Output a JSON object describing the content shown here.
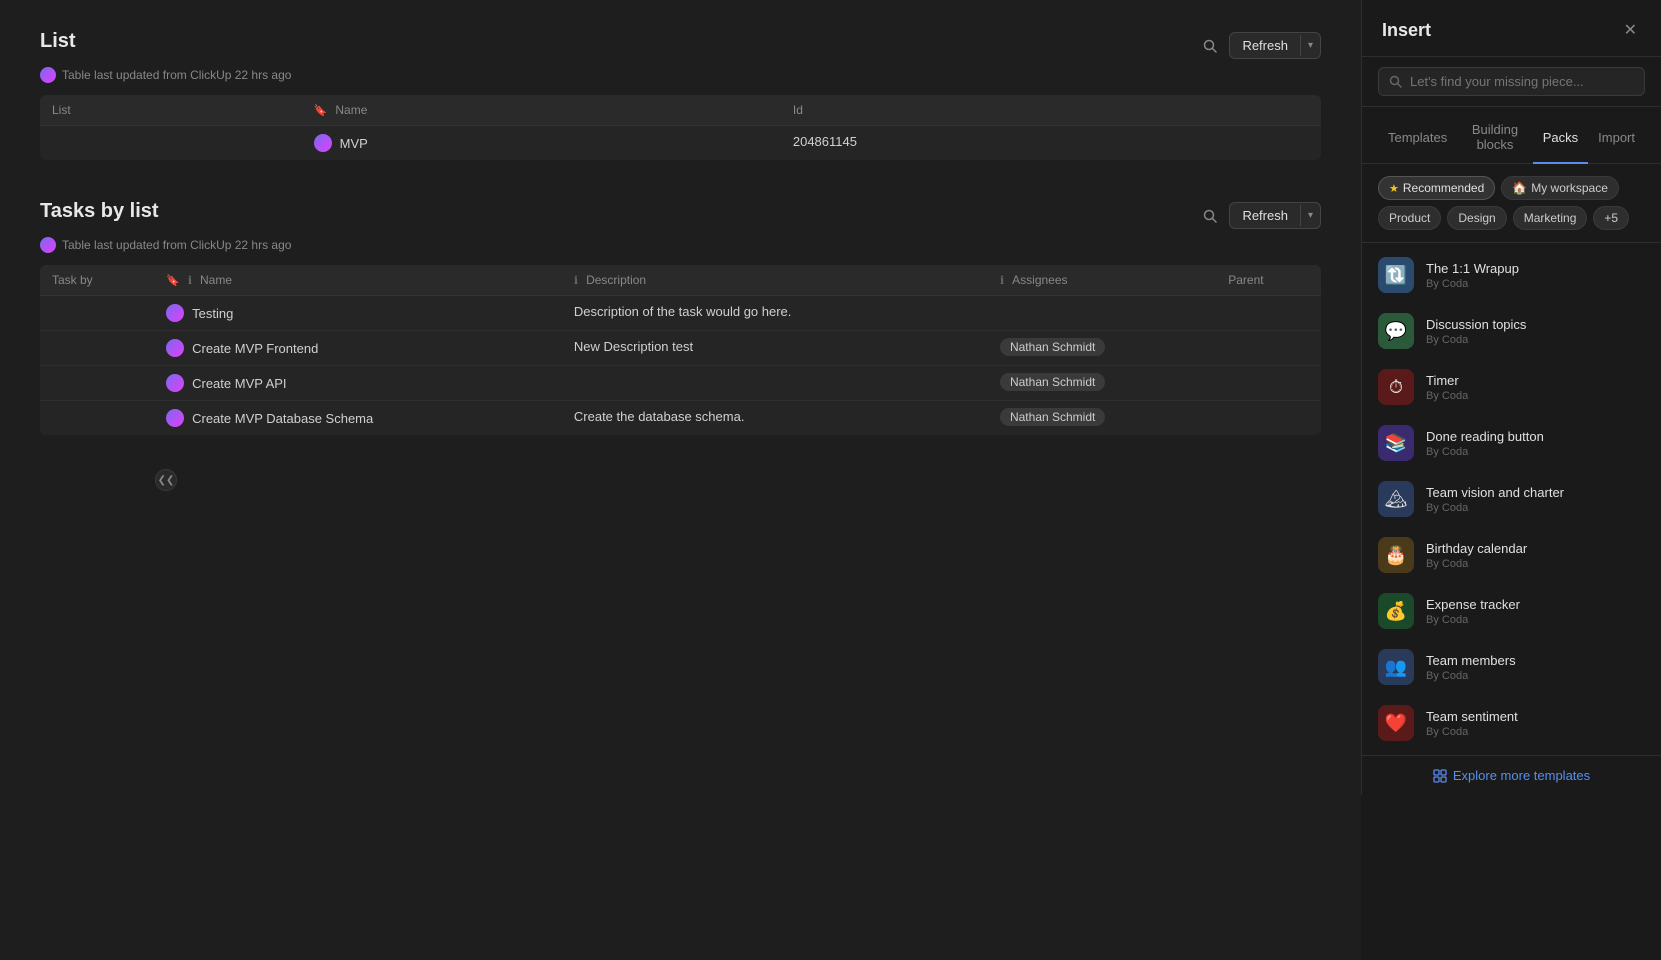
{
  "leftToggle": "❮❮",
  "mainContent": {
    "listSection": {
      "title": "List",
      "tableMeta": "Table last updated from ClickUp 22 hrs ago",
      "refreshBtn": "Refresh",
      "columns": [
        "List",
        "Name",
        "Id"
      ],
      "rows": [
        {
          "list": "",
          "name": "MVP",
          "id": "204861145"
        }
      ]
    },
    "tasksByListSection": {
      "title": "Tasks by list",
      "tableMeta": "Table last updated from ClickUp 22 hrs ago",
      "refreshBtn": "Refresh",
      "columns": [
        "Task by",
        "Name",
        "Description",
        "Assignees",
        "Parent"
      ],
      "rows": [
        {
          "name": "Testing",
          "description": "Description of the task would go here.",
          "assignees": "",
          "parent": ""
        },
        {
          "name": "Create MVP Frontend",
          "description": "New Description test",
          "assignees": "Nathan Schmidt",
          "parent": ""
        },
        {
          "name": "Create MVP API",
          "description": "",
          "assignees": "Nathan Schmidt",
          "parent": ""
        },
        {
          "name": "Create MVP Database Schema",
          "description": "Create the database schema.",
          "assignees": "Nathan Schmidt",
          "parent": ""
        }
      ]
    }
  },
  "rightPanel": {
    "title": "Insert",
    "searchPlaceholder": "Let's find your missing piece...",
    "tabs": [
      "Templates",
      "Building blocks",
      "Packs",
      "Import"
    ],
    "activeTab": "Packs",
    "filters": {
      "recommended": "Recommended",
      "myWorkspace": "My workspace",
      "product": "Product",
      "design": "Design",
      "marketing": "Marketing",
      "more": "+5"
    },
    "items": [
      {
        "name": "The 1:1 Wrapup",
        "author": "By Coda",
        "icon": "🔃",
        "iconBg": "#2a4a6e"
      },
      {
        "name": "Discussion topics",
        "author": "By Coda",
        "icon": "💬",
        "iconBg": "#2a5a3a"
      },
      {
        "name": "Timer",
        "author": "By Coda",
        "icon": "⏱",
        "iconBg": "#6a1a1a"
      },
      {
        "name": "Done reading button",
        "author": "By Coda",
        "icon": "📚",
        "iconBg": "#3a2a6e"
      },
      {
        "name": "Team vision and charter",
        "author": "By Coda",
        "icon": "🏔",
        "iconBg": "#2a3a5a"
      },
      {
        "name": "Birthday calendar",
        "author": "By Coda",
        "icon": "🎂",
        "iconBg": "#4a3a1a"
      },
      {
        "name": "Expense tracker",
        "author": "By Coda",
        "icon": "💰",
        "iconBg": "#1a4a2a"
      },
      {
        "name": "Team members",
        "author": "By Coda",
        "icon": "👥",
        "iconBg": "#2a3a5a"
      },
      {
        "name": "Team sentiment",
        "author": "By Coda",
        "icon": "❤️",
        "iconBg": "#5a1a1a"
      }
    ],
    "exploreLink": "Explore more templates"
  }
}
